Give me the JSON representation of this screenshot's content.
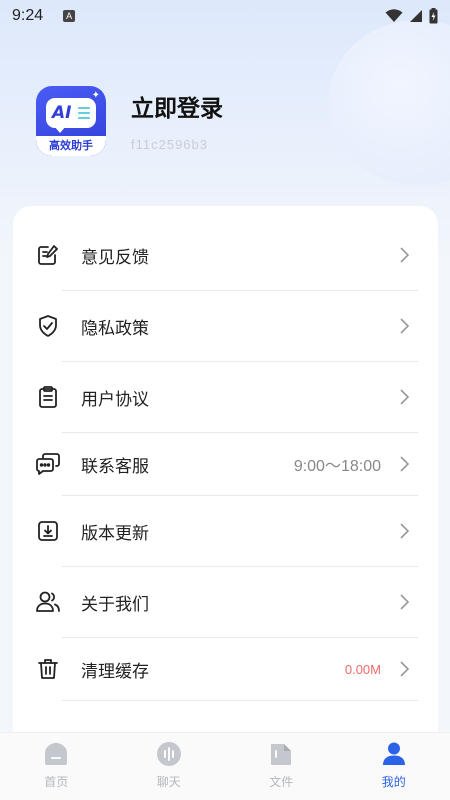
{
  "status_bar": {
    "time": "9:24",
    "indicator": "A"
  },
  "profile": {
    "login_title": "立即登录",
    "user_id": "f11c2596b3",
    "logo_text": "AI",
    "logo_tag": "高效助手"
  },
  "menu": {
    "items": [
      {
        "label": "意见反馈",
        "value": "",
        "icon": "feedback-edit-icon"
      },
      {
        "label": "隐私政策",
        "value": "",
        "icon": "shield-check-icon"
      },
      {
        "label": "用户协议",
        "value": "",
        "icon": "clipboard-icon"
      },
      {
        "label": "联系客服",
        "value": "9:00～18:00",
        "icon": "chat-bubbles-icon"
      },
      {
        "label": "版本更新",
        "value": "",
        "icon": "download-box-icon"
      },
      {
        "label": "关于我们",
        "value": "",
        "icon": "users-icon"
      },
      {
        "label": "清理缓存",
        "value": "0.00M",
        "icon": "trash-icon"
      }
    ]
  },
  "bottom_nav": {
    "items": [
      {
        "label": "首页",
        "icon": "home-icon",
        "active": false
      },
      {
        "label": "聊天",
        "icon": "voice-chat-icon",
        "active": false
      },
      {
        "label": "文件",
        "icon": "file-icon",
        "active": false
      },
      {
        "label": "我的",
        "icon": "person-icon",
        "active": true
      }
    ]
  },
  "colors": {
    "accent": "#2b63e8",
    "cache_value": "#f06a6a",
    "logo": "#3b4ce8"
  }
}
